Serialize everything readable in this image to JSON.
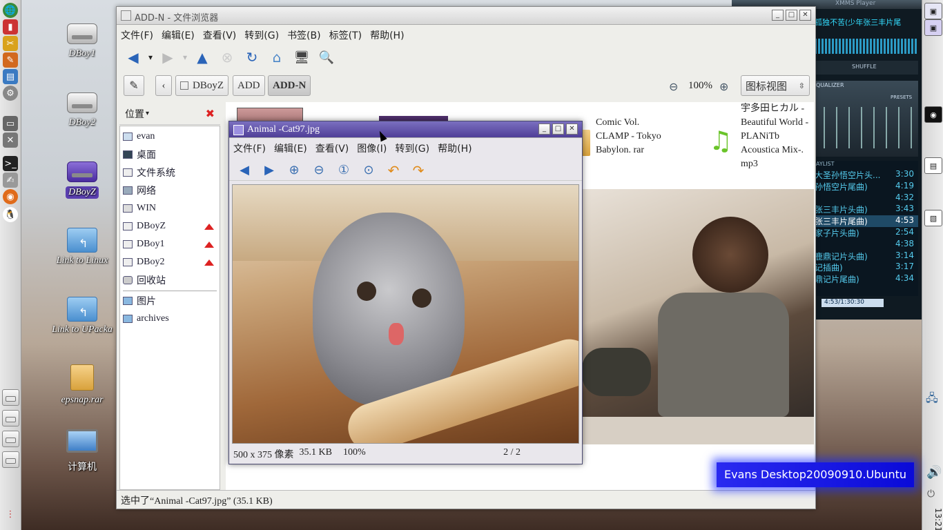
{
  "desktop": {
    "icons": [
      {
        "label": "DBoy1",
        "kind": "drive"
      },
      {
        "label": "DBoy2",
        "kind": "drive"
      },
      {
        "label": "DBoyZ",
        "kind": "drive-selected"
      },
      {
        "label": "Link to Linux",
        "kind": "link"
      },
      {
        "label": "Link to UPacka",
        "kind": "link"
      },
      {
        "label": "epsnap.rar",
        "kind": "archive"
      },
      {
        "label": "计算机",
        "kind": "computer"
      }
    ],
    "watermark": "Evans Desktop20090910.Ubuntu"
  },
  "panel": {
    "clock": "13:21"
  },
  "xmms": {
    "title": "XMMS Player",
    "now_playing": "孤独不苦(少年张三丰片尾",
    "track_time": "4:53/1:30:30",
    "shuffle_label": "SHUFFLE",
    "equalizer_label": "QUALIZER",
    "presets_label": "PRESETS",
    "playlist_label": "AYLIST",
    "playlist": [
      {
        "title": "大圣孙悟空片头...",
        "time": "3:30"
      },
      {
        "title": "孙悟空片尾曲)",
        "time": "4:19"
      },
      {
        "title": "",
        "time": "4:32"
      },
      {
        "title": "张三丰片头曲)",
        "time": "3:43"
      },
      {
        "title": "张三丰片尾曲)",
        "time": "4:53"
      },
      {
        "title": "家子片头曲)",
        "time": "2:54"
      },
      {
        "title": "",
        "time": "4:38"
      },
      {
        "title": "鹿鼎记片头曲)",
        "time": "3:14"
      },
      {
        "title": "记插曲)",
        "time": "3:17"
      },
      {
        "title": "鼎记片尾曲)",
        "time": "4:34"
      }
    ]
  },
  "filemanager": {
    "title": "ADD-N - 文件浏览器",
    "menu": [
      "文件(F)",
      "编辑(E)",
      "查看(V)",
      "转到(G)",
      "书签(B)",
      "标签(T)",
      "帮助(H)"
    ],
    "breadcrumbs": [
      "DBoyZ",
      "ADD",
      "ADD-N"
    ],
    "zoom": "100%",
    "view_mode": "图标视图",
    "sidebar_header": "位置",
    "places": [
      "evan",
      "桌面",
      "文件系统",
      "网络",
      "WIN",
      "DBoyZ",
      "DBoy1",
      "DBoy2",
      "回收站"
    ],
    "bookmarks": [
      "图片",
      "archives"
    ],
    "files": [
      {
        "name": "Comic Vol. CLAMP - Tokyo Babylon. rar"
      },
      {
        "name": "宇多田ヒカル -Beautiful World - PLANiTb Acoustica Mix-. mp3"
      }
    ],
    "status": "选中了“Animal -Cat97.jpg” (35.1 KB)"
  },
  "viewer": {
    "title": "Animal -Cat97.jpg",
    "menu": [
      "文件(F)",
      "编辑(E)",
      "查看(V)",
      "图像(I)",
      "转到(G)",
      "帮助(H)"
    ],
    "status_dims": "500 x 375 像素",
    "status_size": "35.1 KB",
    "status_zoom": "100%",
    "status_index": "2 / 2"
  },
  "colors": {
    "accent": "#4f3f97",
    "selection": "#5a3fb0",
    "watermark_bg": "#1010d0"
  }
}
